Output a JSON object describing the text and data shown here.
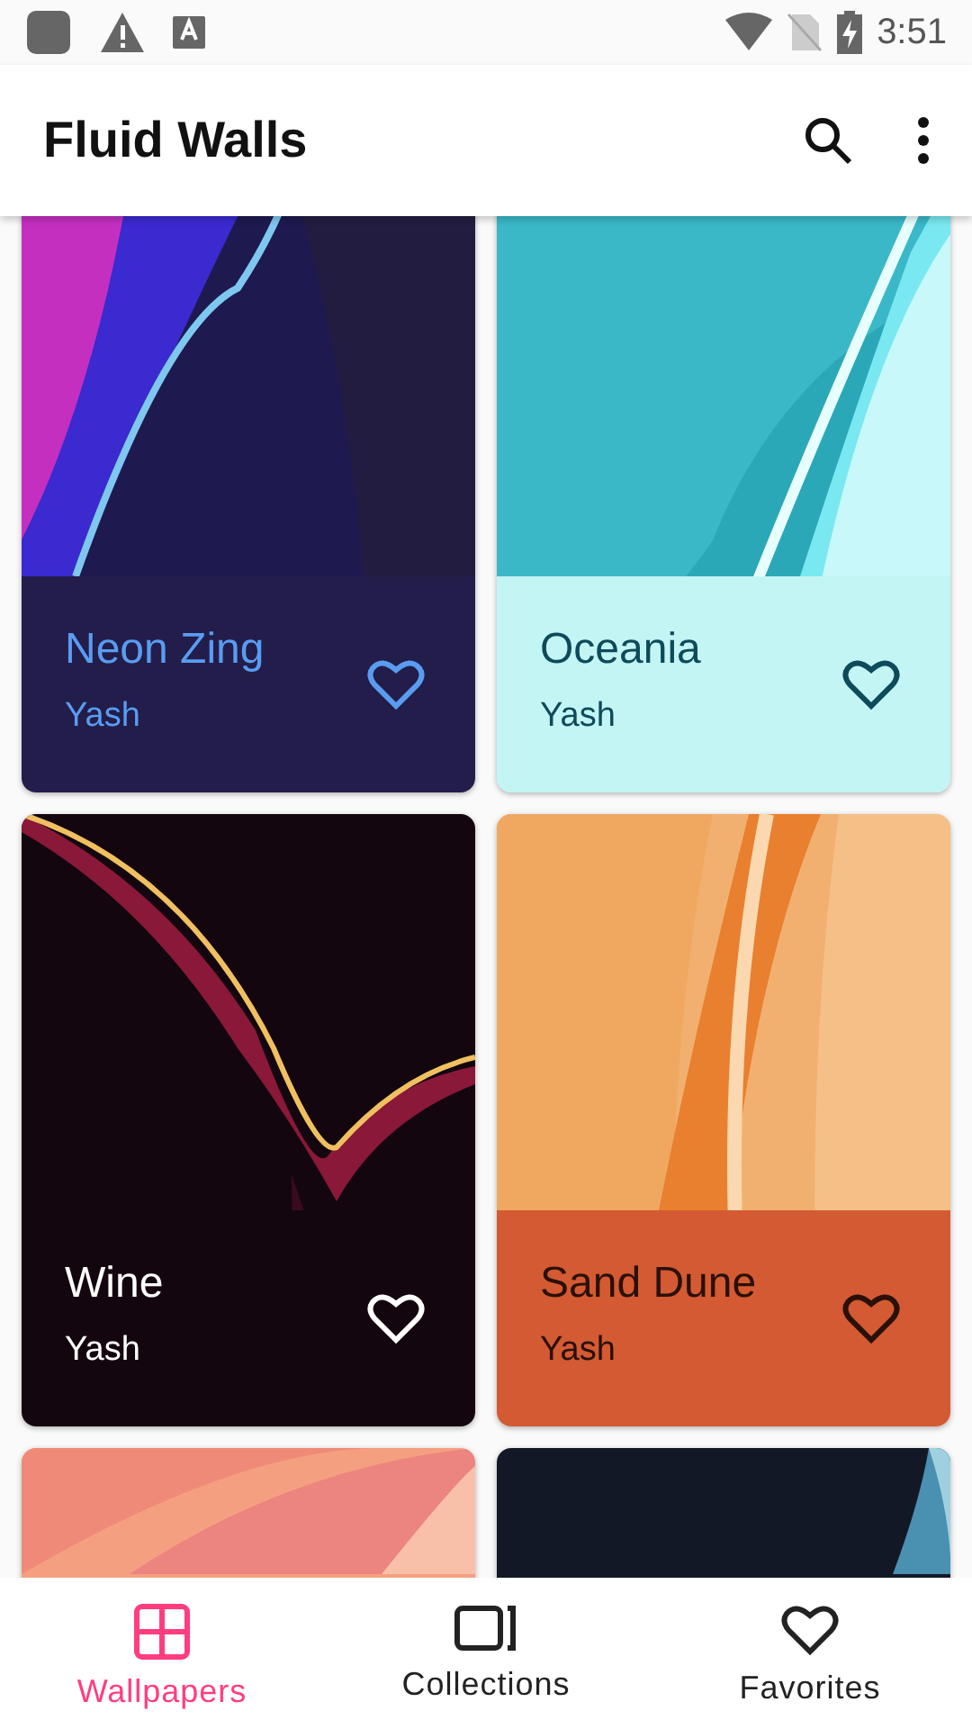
{
  "status_bar": {
    "time": "3:51"
  },
  "app_bar": {
    "title": "Fluid Walls"
  },
  "wallpapers": [
    {
      "title": "Neon Zing",
      "author": "Yash",
      "color": "#221d4a",
      "favorite": false
    },
    {
      "title": "Oceania",
      "author": "Yash",
      "color": "#c4f5f5",
      "favorite": false
    },
    {
      "title": "Wine",
      "author": "Yash",
      "color": "#14060f",
      "favorite": false
    },
    {
      "title": "Sand Dune",
      "author": "Yash",
      "color": "#d35a32",
      "favorite": false
    },
    {
      "kind": "picture"
    },
    {
      "kind": "picture"
    }
  ],
  "bottom_nav": [
    {
      "label": "Wallpapers",
      "selected": true
    },
    {
      "label": "Collections",
      "selected": false
    },
    {
      "label": "Favorites",
      "selected": false
    }
  ]
}
